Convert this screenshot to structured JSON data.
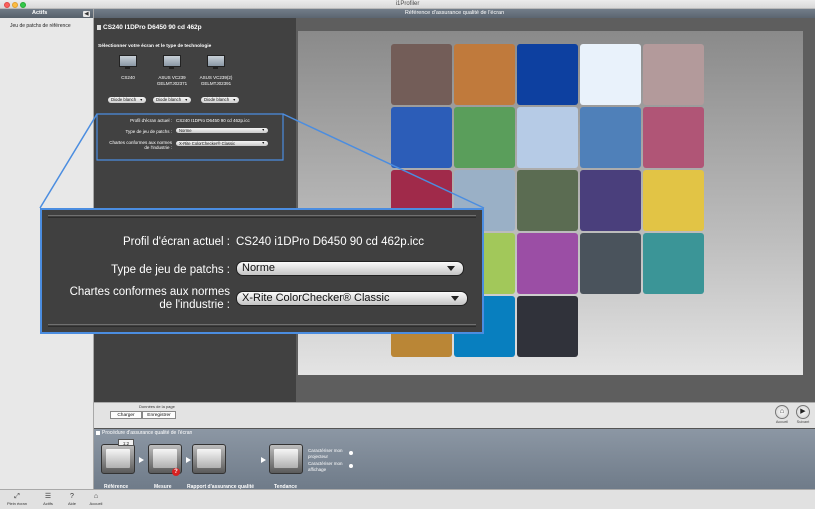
{
  "window": {
    "title": "i1Profiler"
  },
  "sidebar": {
    "header": "Actifs",
    "items": [
      "Jeu de patchs de référence"
    ]
  },
  "breadcrumb": "Référence d'assurance qualité de l'écran",
  "main": {
    "profile_heading": "CS240 I1DPro D6450 90 cd 462p",
    "display_heading": "Sélectionner votre écran et le type de technologie",
    "displays": [
      {
        "name": "CS240",
        "serial": "",
        "type": "Diode blanch"
      },
      {
        "name": "ASUS VC239",
        "serial": "GELMTJ02371",
        "type": "Diode blanch"
      },
      {
        "name": "ASUS VC239(2)",
        "serial": "GELMTJ02391",
        "type": "Diode blanch"
      }
    ],
    "settings": {
      "profile_label": "Profil d'écran actuel :",
      "profile_value": "CS240 I1DPro D6450 90 cd 462p.icc",
      "patchset_label": "Type de jeu de patchs :",
      "patchset_value": "Norme",
      "charts_label_line1": "Chartes conformes aux normes",
      "charts_label_line2": "de l'industrie :",
      "charts_value": "X-Rite ColorChecker® Classic"
    }
  },
  "zoom": {
    "profile_label": "Profil d'écran actuel :",
    "profile_value": "CS240 i1DPro D6450 90 cd 462p.icc",
    "patchset_label": "Type de jeu de patchs :",
    "patchset_value": "Norme",
    "charts_label_line1": "Chartes conformes aux normes",
    "charts_label_line2": "de l'industrie :",
    "charts_value": "X-Rite ColorChecker® Classic"
  },
  "chart": {
    "patch_colors": [
      "#735d58",
      "#c07a3c",
      "#0d40a0",
      "#e9f2fb",
      "#b39a9b",
      "#2c5db8",
      "#5a9e5b",
      "#b6cbe6",
      "#4f80b9",
      "#b05576",
      "#a02a4a",
      "#9ab0c6",
      "#5b6c52",
      "#4a3f7c",
      "#e2c445",
      "#6478b6",
      "#a2c85a",
      "#9b4ea5",
      "#4a535c",
      "#3b9597",
      "#ba8636",
      "#087fbf",
      "#30323a"
    ]
  },
  "loadsave": {
    "label": "Données de la page",
    "load": "Charger",
    "save": "Enregistrer",
    "home_label": "Accueil",
    "next_label": "Suivant"
  },
  "workflow": {
    "title": "Procédure d'assurance qualité de l'écran",
    "steps": [
      {
        "label": "Référence",
        "badge": "1:2"
      },
      {
        "label": "Mesure"
      },
      {
        "label": "Rapport d'assurance qualité"
      },
      {
        "label": "Tendance"
      }
    ],
    "link1_line1": "Caractériser mon",
    "link1_line2": "projecteur",
    "link2_line1": "Caractériser mon",
    "link2_line2": "affichage"
  },
  "toolbar": {
    "items": [
      {
        "label": "Plein écran",
        "icon": "fullscreen-icon"
      },
      {
        "label": "Actifs",
        "icon": "list-icon"
      },
      {
        "label": "Aide",
        "icon": "help-icon"
      },
      {
        "label": "Accueil",
        "icon": "home-icon"
      }
    ]
  }
}
